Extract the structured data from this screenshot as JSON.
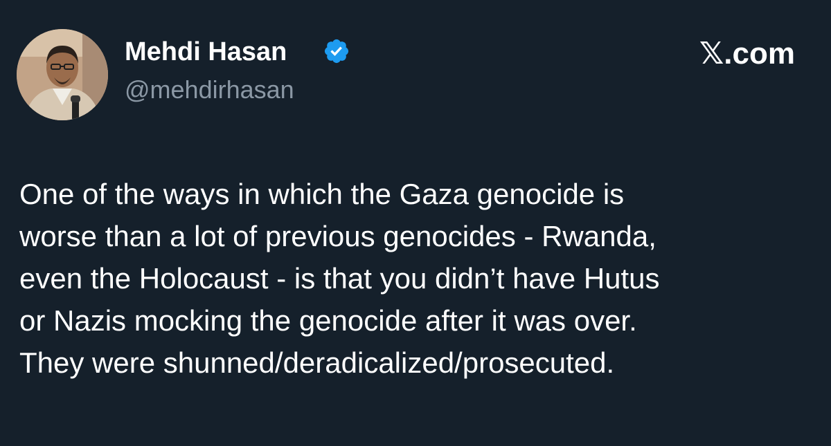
{
  "tweet": {
    "author": {
      "name": "Mehdi Hasan",
      "handle": "@mehdirhasan",
      "verified_icon": "verified-badge-icon",
      "verified_color": "#1d9bf0"
    },
    "brand": "𝕏.com",
    "text_lines": [
      "One of the ways in which the Gaza genocide is",
      "worse than a lot of previous genocides - Rwanda,",
      "even the Holocaust - is that you didn’t have Hutus",
      "or Nazis mocking the genocide after it was over.",
      "They were shunned/deradicalized/prosecuted."
    ]
  },
  "colors": {
    "background": "#15202b",
    "text": "#ffffff",
    "secondary_text": "#8b98a5"
  }
}
